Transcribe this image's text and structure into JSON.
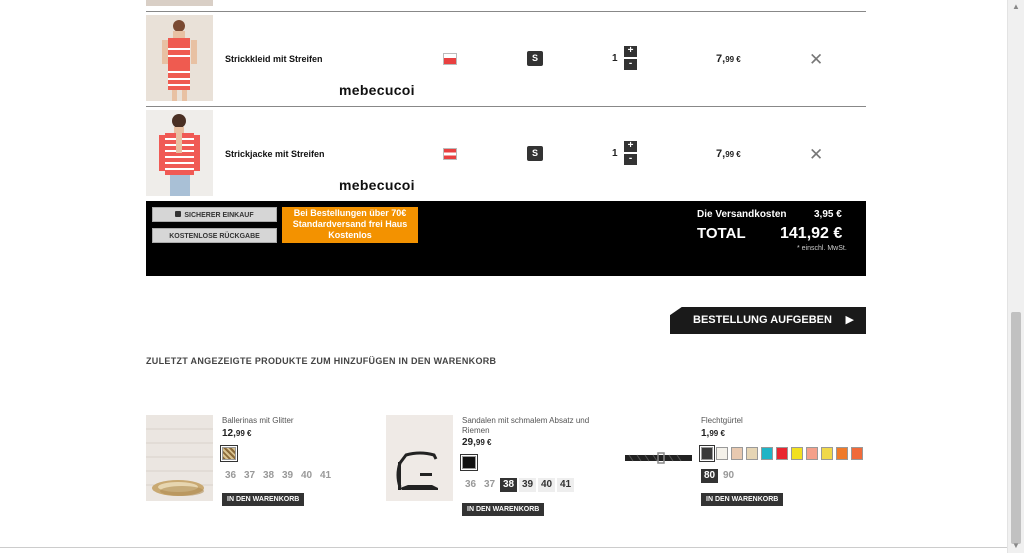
{
  "cart": {
    "items": [
      {
        "name": "Strickkleid mit Streifen",
        "watermark": "mebecucoi",
        "color": "#e94040",
        "size": "S",
        "qty": "1",
        "price_main": "7,",
        "price_cents": "99 €",
        "plus": "+",
        "minus": "-",
        "remove": "✕"
      },
      {
        "name": "Strickjacke mit Streifen",
        "watermark": "mebecucoi",
        "color": "#e94040",
        "size": "S",
        "qty": "1",
        "price_main": "7,",
        "price_cents": "99 €",
        "plus": "+",
        "minus": "-",
        "remove": "✕"
      }
    ]
  },
  "summary": {
    "secure_label": "SICHERER EINKAUF",
    "return_label": "KOSTENLOSE RÜCKGABE",
    "promo_line1": "Bei Bestellungen über 70€",
    "promo_line2": "Standardversand frei Haus",
    "promo_line3": "Kostenlos",
    "shipping_label": "Die Versandkosten",
    "shipping_value": "3,95  €",
    "total_label": "TOTAL",
    "total_value": "141,92  €",
    "vat_note": "* einschl. MwSt."
  },
  "order_button": {
    "label": "BESTELLUNG AUFGEBEN",
    "arrow": "▶"
  },
  "recent": {
    "title": "ZULETZT ANGEZEIGTE PRODUKTE ZUM HINZUFÜGEN IN DEN WARENKORB",
    "cart_label": "IN DEN WARENKORB",
    "products": [
      {
        "name": "Ballerinas mit Glitter",
        "price_main": "12,",
        "price_cents": "99 €",
        "swatches": [
          "#b89a6a"
        ],
        "sizes": [
          "36",
          "37",
          "38",
          "39",
          "40",
          "41"
        ]
      },
      {
        "name": "Sandalen mit schmalem Absatz und Riemen",
        "price_main": "29,",
        "price_cents": "99 €",
        "swatches": [
          "#111111"
        ],
        "sizes": [
          "36",
          "37",
          "38",
          "39",
          "40",
          "41"
        ]
      },
      {
        "name": "Flechtgürtel",
        "price_main": "1,",
        "price_cents": "99 €",
        "swatches": [
          "#3a3a3a",
          "#f4f1ea",
          "#e8c9b0",
          "#e6d5b4",
          "#1fb4c6",
          "#e9262f",
          "#f2e020",
          "#f4a08a",
          "#f0d84a",
          "#f07a2a",
          "#f06a3a"
        ],
        "sizes": [
          "80",
          "90"
        ]
      }
    ]
  }
}
